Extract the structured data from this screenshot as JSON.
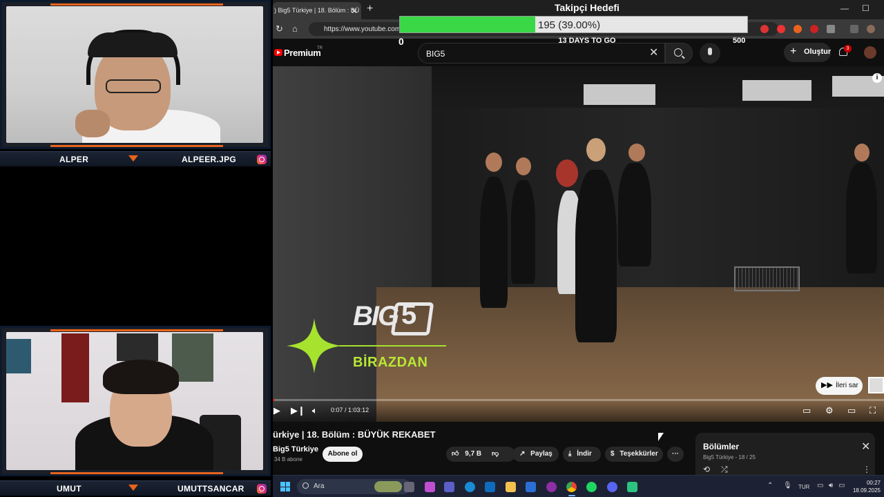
{
  "stream": {
    "top_cam": {
      "left_name": "ALPER",
      "right_name": "ALPEER.JPG"
    },
    "bottom_cam": {
      "left_name": "UMUT",
      "right_name": "UMUTTSANCAR"
    },
    "accent_color": "#e8641c"
  },
  "follower_goal": {
    "title": "Takipçi Hedefi",
    "current_text": "195 (39.00%)",
    "progress_fraction": 0.39,
    "min_label": "0",
    "max_label": "500",
    "days_left": "13 DAYS TO GO",
    "fill_color": "#3ad847"
  },
  "browser": {
    "tab_title": ") Big5 Türkiye | 18. Bölüm : BÜ",
    "tab_close": "✕",
    "new_tab": "+",
    "url": "https://www.youtube.com",
    "window_min": "—",
    "window_max": "☐"
  },
  "youtube": {
    "logo_text": "Premium",
    "region": "TR",
    "search_value": "BIG5",
    "create_label": "Oluştur",
    "notifications_count": "3"
  },
  "video": {
    "brand": "BIG",
    "brand_number": "5",
    "brand_subtitle": "BİRAZDAN",
    "skip_label": "İleri sar",
    "info": "i",
    "time_current": "0:07",
    "time_total": "1:03:12",
    "time_separator": " / ",
    "played_fraction": 0.002,
    "title": "ürkiye | 18. Bölüm : BÜYÜK REKABET",
    "channel": "Big5 Türkiye",
    "subscribers": "34 B abone",
    "subscribe_label": "Abone ol",
    "like_count": "9,7 B",
    "share_label": "Paylaş",
    "download_label": "İndir",
    "thanks_label": "Teşekkürler",
    "more_label": "···"
  },
  "playlist_panel": {
    "title": "Bölümler",
    "subtitle": "Big5 Türkiye - 18 / 25",
    "close": "✕"
  },
  "taskbar": {
    "search_placeholder": "Ara",
    "language": "TUR",
    "time": "00:27",
    "date": "18.09.2025"
  }
}
